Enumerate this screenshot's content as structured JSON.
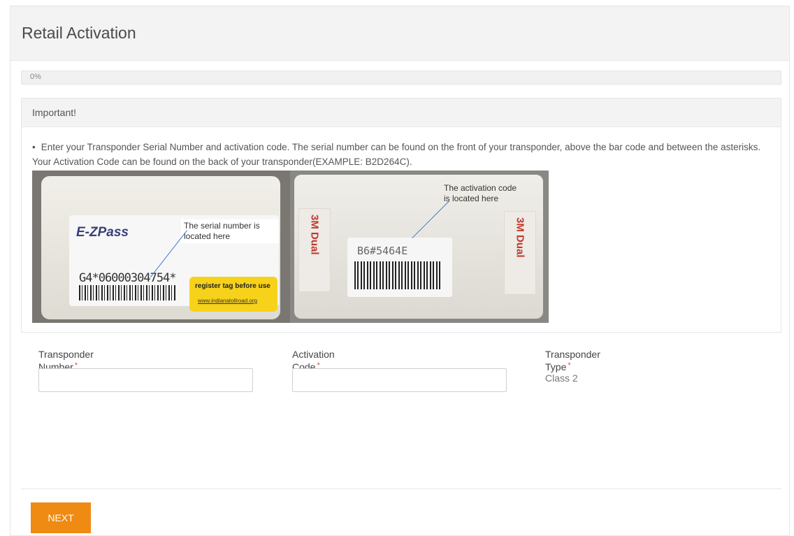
{
  "page": {
    "title": "Retail Activation"
  },
  "progress": {
    "percent": 0,
    "label": "0%"
  },
  "notice": {
    "heading": "Important!",
    "bullet": "•",
    "text": "Enter your Transponder Serial Number and activation code. The serial number can be found on the front of your transponder, above the bar code and between the asterisks. Your Activation Code can be found on the back of your transponder(EXAMPLE: B2D264C)."
  },
  "image": {
    "front": {
      "brand": "E-ZPass",
      "callout": "The serial number is located here",
      "serial": "G4*06000304754*",
      "sticker_line1": "register tag before use",
      "sticker_line2": "www.indianatollroad.org"
    },
    "back": {
      "callout": "The activation code is located here",
      "code": "B6#5464E",
      "tape_text": "3M Dual"
    }
  },
  "form": {
    "transponder_number": {
      "label": "Transponder Number",
      "required": "*",
      "value": ""
    },
    "activation_code": {
      "label": "Activation Code",
      "required": "*",
      "value": ""
    },
    "transponder_type": {
      "label": "Transponder Type",
      "required": "*",
      "value": "Class 2"
    }
  },
  "actions": {
    "next_label": "NEXT"
  },
  "colors": {
    "accent": "#ef8a13",
    "required": "#e74c3c"
  }
}
